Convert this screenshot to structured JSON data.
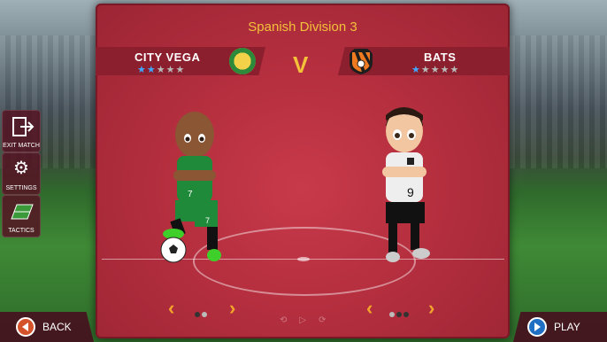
{
  "match": {
    "division": "Spanish Division 3",
    "vs_label": "V"
  },
  "home": {
    "name": "CITY VEGA",
    "stars_on": "★★",
    "stars_off": "★★★"
  },
  "away": {
    "name": "BATS",
    "stars_on": "★",
    "stars_off": "★★★★"
  },
  "side_menu": {
    "exit": "EXIT MATCH",
    "settings": "SETTINGS",
    "tactics": "TACTICS"
  },
  "bottom": {
    "back": "BACK",
    "play": "PLAY"
  },
  "kits": {
    "home_number": "7",
    "away_number": "9"
  },
  "colors": {
    "accent": "#f3c13a",
    "panel": "#b52f3f",
    "star": "#3fa7ff"
  }
}
